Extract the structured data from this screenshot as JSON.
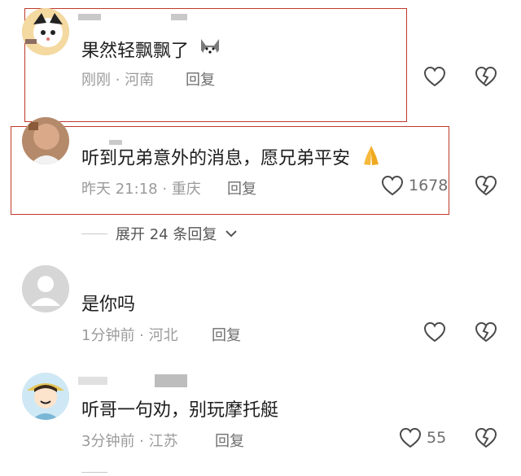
{
  "comments": [
    {
      "text": "果然轻飘飘了",
      "emoji": "dog-face-emoji",
      "meta": "刚刚 · 河南",
      "reply": "回复",
      "likes": ""
    },
    {
      "text": "听到兄弟意外的消息，愿兄弟平安",
      "emoji": "folded-hands-emoji",
      "meta": "昨天 21:18 · 重庆",
      "reply": "回复",
      "likes": "1678"
    },
    {
      "text": "是你吗",
      "meta": "1分钟前 · 河北",
      "reply": "回复",
      "likes": ""
    },
    {
      "text": "听哥一句劝，别玩摩托艇",
      "meta": "3分钟前 · 江苏",
      "reply": "回复",
      "likes": "55"
    }
  ],
  "expand_replies": "展开 24 条回复",
  "colors": {
    "highlight": "#c0392b",
    "meta": "#9b9b9b"
  }
}
